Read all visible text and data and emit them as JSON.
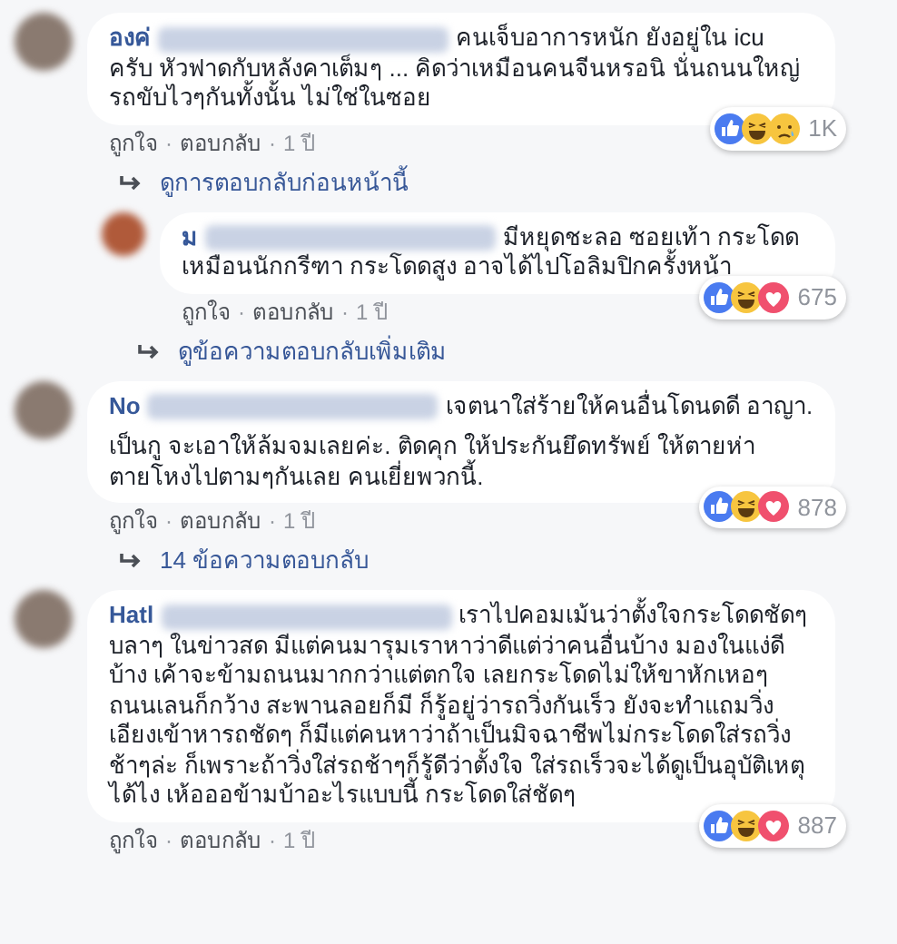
{
  "comments": [
    {
      "author": "องค่",
      "paragraphs": [
        "คนเจ็บอาการหนัก ยังอยู่ใน icu ครับ หัวฟาดกับหลังคาเต็มๆ ... คิดว่าเหมือนคนจีนหรอนิ นั่นถนนใหญ่รถขับไวๆกันทั้งนั้น ไม่ใช่ในซอย"
      ],
      "reactions": [
        {
          "kind": "like"
        },
        {
          "kind": "haha"
        },
        {
          "kind": "sad"
        }
      ],
      "reaction_count": "1K",
      "actions": [
        "ถูกใจ",
        "ตอบกลับ"
      ],
      "separator": "·",
      "time": "1 ปี",
      "reply_link": "ดูการตอบกลับก่อนหน้านี้",
      "replies": [
        {
          "author": "ม",
          "paragraphs": [
            "มีหยุดชะลอ ซอยเท้า กระโดด เหมือนนักกรีฑา กระโดดสูง อาจได้ไปโอลิมปิกครั้งหน้า"
          ],
          "reactions": [
            {
              "kind": "like"
            },
            {
              "kind": "haha"
            },
            {
              "kind": "love"
            }
          ],
          "reaction_count": "675",
          "actions": [
            "ถูกใจ",
            "ตอบกลับ"
          ],
          "separator": "·",
          "time": "1 ปี",
          "reply_link": "ดูข้อความตอบกลับเพิ่มเติม"
        }
      ]
    },
    {
      "author": "No",
      "paragraphs": [
        "เจตนาใส่ร้ายให้คนอื่นโดนดดี อาญา.",
        "เป็นกู จะเอาให้ล้มจมเลยค่ะ. ติดคุก ให้ประกันยึดทรัพย์ ให้ตายห่าตายโหงไปตามๆกันเลย คนเยี่ยพวกนี้."
      ],
      "reactions": [
        {
          "kind": "like"
        },
        {
          "kind": "haha"
        },
        {
          "kind": "love"
        }
      ],
      "reaction_count": "878",
      "actions": [
        "ถูกใจ",
        "ตอบกลับ"
      ],
      "separator": "·",
      "time": "1 ปี",
      "reply_link": "14 ข้อความตอบกลับ"
    },
    {
      "author": "Hatl",
      "paragraphs": [
        "เราไปคอมเม้นว่าตั้งใจกระโดดชัดๆ บลาๆ ในข่าวสด มีแต่คนมารุมเราหาว่าดีแต่ว่าคนอื่นบ้าง มองในแง่ดีบ้าง เค้าจะข้ามถนนมากกว่าแต่ตกใจ เลยกระโดดไม่ให้ขาหักเหอๆ ถนนเลนก็กว้าง สะพานลอยก็มี ก็รู้อยู่ว่ารถวิ่งกันเร็ว ยังจะทำแถมวิ่งเอียงเข้าหารถชัดๆ ก็มีแต่คนหาว่าถ้าเป็นมิจฉาชีพไม่กระโดดใส่รถวิ่งช้าๆล่ะ ก็เพราะถ้าวิ่งใส่รถช้าๆก็รู้ดีว่าตั้งใจ ใส่รถเร็วจะได้ดูเป็นอุบัติเหตุได้ไง เห้อออข้ามบ้าอะไรแบบนี้ กระโดดใส่ชัดๆ"
      ],
      "reactions": [
        {
          "kind": "like"
        },
        {
          "kind": "haha"
        },
        {
          "kind": "love"
        }
      ],
      "reaction_count": "887",
      "actions": [
        "ถูกใจ",
        "ตอบกลับ"
      ],
      "separator": "·",
      "time": "1 ปี"
    }
  ]
}
